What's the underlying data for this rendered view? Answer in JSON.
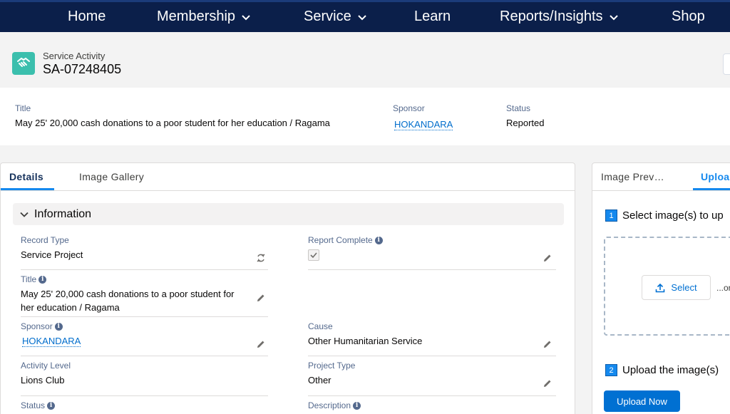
{
  "nav": {
    "items": [
      {
        "label": "Home",
        "has_dropdown": false
      },
      {
        "label": "Membership",
        "has_dropdown": true
      },
      {
        "label": "Service",
        "has_dropdown": true
      },
      {
        "label": "Learn",
        "has_dropdown": false
      },
      {
        "label": "Reports/Insights",
        "has_dropdown": true
      },
      {
        "label": "Shop",
        "has_dropdown": false
      }
    ]
  },
  "record": {
    "icon": "handshake-icon",
    "type": "Service Activity",
    "name": "SA-07248405",
    "icon_color": "#3bbfad"
  },
  "highlights": {
    "title_label": "Title",
    "title_value": "May 25' 20,000 cash donations to a poor student for her education / Ragama",
    "sponsor_label": "Sponsor",
    "sponsor_value": "HOKANDARA",
    "status_label": "Status",
    "status_value": "Reported"
  },
  "tabs": {
    "details": "Details",
    "image_gallery": "Image Gallery"
  },
  "section": {
    "title": "Information"
  },
  "fields": {
    "record_type_label": "Record Type",
    "record_type_value": "Service Project",
    "report_complete_label": "Report Complete",
    "report_complete_checked": true,
    "title_label": "Title",
    "title_value": "May 25' 20,000 cash donations to a poor student for her education / Ragama",
    "sponsor_label": "Sponsor",
    "sponsor_value": "HOKANDARA",
    "cause_label": "Cause",
    "cause_value": "Other Humanitarian Service",
    "activity_level_label": "Activity Level",
    "activity_level_value": "Lions Club",
    "project_type_label": "Project Type",
    "project_type_value": "Other",
    "status_label": "Status",
    "description_label": "Description"
  },
  "right_panel": {
    "tabs": {
      "image_preview": "Image Prev…",
      "upload": "Uploa"
    },
    "step1_num": "1",
    "step1_text": "Select image(s) to up",
    "select_button": "Select",
    "or_text": "...or",
    "step2_num": "2",
    "step2_text": "Upload the image(s)",
    "upload_button": "Upload Now"
  },
  "colors": {
    "nav_bg": "#0b1f4a",
    "accent": "#1589ee",
    "link": "#006dcc",
    "primary_button": "#0070d2"
  }
}
